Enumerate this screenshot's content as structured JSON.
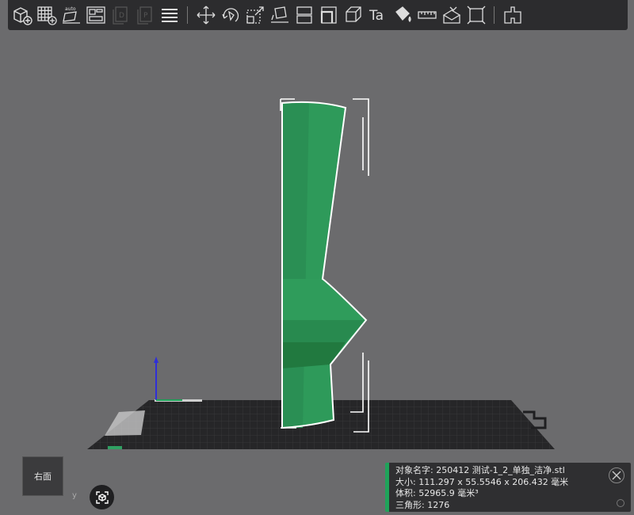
{
  "toolbar": {
    "icons": [
      "add-cube-icon",
      "add-plate-icon",
      "auto-orient-icon",
      "arrange-icon",
      "copy-disabled-icon",
      "paste-disabled-icon",
      "layers-menu-icon",
      "move-icon",
      "rotate-icon",
      "scale-icon",
      "lay-on-face-icon",
      "split-icon",
      "cut-icon",
      "cut-corner-icon",
      "text-icon",
      "paint-icon",
      "measure-icon",
      "support-paint-icon",
      "fit-icon",
      "assemble-icon"
    ],
    "auto_label": "auto",
    "text_tool_label": "Ta"
  },
  "viewport": {
    "model_color": "#2e9a5a",
    "bed_color": "#2a2a2c",
    "view_button_label": "右面",
    "axis_label": "y"
  },
  "info": {
    "name_label": "对象名字:",
    "name_value": "250412 测试-1_2_单独_洁净.stl",
    "size_label": "大小:",
    "size_value": "111.297 x 55.5546 x 206.432 毫米",
    "volume_label": "体积:",
    "volume_value": "52965.9 毫米³",
    "triangles_label": "三角形:",
    "triangles_value": "1276",
    "accent_color": "#1fa35a"
  }
}
